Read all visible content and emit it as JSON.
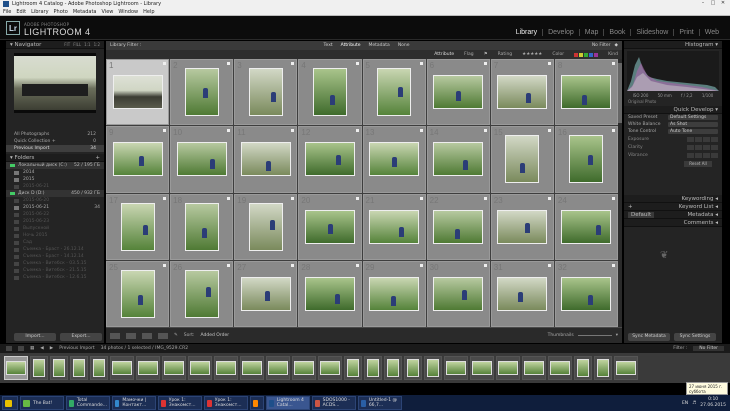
{
  "window": {
    "title": "Lightroom 4 Catalog - Adobe Photoshop Lightroom - Library"
  },
  "menu": [
    "File",
    "Edit",
    "Library",
    "Photo",
    "Metadata",
    "View",
    "Window",
    "Help"
  ],
  "identity": {
    "small": "ADOBE PHOTOSHOP",
    "big": "LIGHTROOM 4"
  },
  "modules": [
    "Library",
    "Develop",
    "Map",
    "Book",
    "Slideshow",
    "Print",
    "Web"
  ],
  "left": {
    "navigator": "Navigator",
    "nav_modes": [
      "FIT",
      "FILL",
      "1:1",
      "1:2"
    ],
    "catalog": [
      {
        "label": "All Photographs",
        "count": "212"
      },
      {
        "label": "Quick Collection +",
        "count": "0"
      },
      {
        "label": "Previous Import",
        "count": "34"
      }
    ],
    "folders_header": "Folders",
    "vol1": {
      "label": "Локальный диск (C:)",
      "info": "52 / 195 ГБ"
    },
    "vol2": {
      "label": "Диск D (D:)",
      "info": "450 / 932 ГБ"
    },
    "folders": [
      {
        "label": "2014",
        "count": "",
        "dim": false
      },
      {
        "label": "2015",
        "count": "",
        "dim": false
      },
      {
        "label": "2015-06-21",
        "count": "",
        "dim": true
      },
      {
        "label": "2015-06-20",
        "count": "",
        "dim": true
      },
      {
        "label": "2015-06-21",
        "count": "34",
        "dim": false
      },
      {
        "label": "2015-06-22",
        "count": "",
        "dim": true
      },
      {
        "label": "2015-06-23",
        "count": "",
        "dim": true
      },
      {
        "label": "Выпускной",
        "count": "",
        "dim": true
      },
      {
        "label": "Ночь 2015",
        "count": "",
        "dim": true
      },
      {
        "label": "Сад",
        "count": "",
        "dim": true
      },
      {
        "label": "Съемка - Браст - 26.12.14",
        "count": "",
        "dim": true
      },
      {
        "label": "Съемка - Браст - 14.12.14",
        "count": "",
        "dim": true
      },
      {
        "label": "Съемка - Витебск - 03.5.15",
        "count": "",
        "dim": true
      },
      {
        "label": "Съемка - Витебск - 21.5.15",
        "count": "",
        "dim": true
      },
      {
        "label": "Съемка - Витебск - 12.6.15",
        "count": "",
        "dim": true
      }
    ],
    "import_label": "Import...",
    "export_label": "Export..."
  },
  "center": {
    "filter_title": "Library Filter :",
    "filter_tabs": [
      "Text",
      "Attribute",
      "Metadata",
      "None"
    ],
    "filter_active": "Attribute",
    "no_filter": "No Filter",
    "attr_labels": [
      "Attribute",
      "Flag",
      "Rating",
      "Color",
      "Kind"
    ],
    "grid_numbers": [
      "1",
      "2",
      "3",
      "4",
      "5",
      "6",
      "7",
      "8",
      "9",
      "10",
      "11",
      "12",
      "13",
      "14",
      "15",
      "16",
      "17",
      "18",
      "19",
      "20",
      "21",
      "22",
      "23",
      "24",
      "25",
      "26",
      "27",
      "28",
      "29",
      "30",
      "31",
      "32"
    ],
    "sort_label": "Sort:",
    "sort_value": "Added Order",
    "thumbnails_label": "Thumbnails"
  },
  "right": {
    "histogram": "Histogram",
    "histo_info": [
      "ISO 200",
      "50 mm",
      "f / 2,2",
      "1/100"
    ],
    "original_photo": "Original Photo",
    "quick_develop": "Quick Develop",
    "saved_preset_label": "Saved Preset",
    "saved_preset_value": "Default Settings",
    "white_balance_label": "White Balance",
    "white_balance_value": "As Shot",
    "tone_control_label": "Tone Control",
    "tone_control_value": "Auto Tone",
    "tone_rows": [
      "Exposure",
      "Clarity",
      "Vibrance"
    ],
    "reset_all": "Reset All",
    "keywording": "Keywording",
    "keyword_list": "Keyword List",
    "metadata": "Metadata",
    "metadata_preset": "Default",
    "comments": "Comments",
    "sync_metadata": "Sync Metadata",
    "sync_settings": "Sync Settings"
  },
  "filmstrip": {
    "source": "Previous Import",
    "info": "34 photos / 1 selected / IMG_9529.CR2",
    "filter_label": "Filter :",
    "filter_value": "No Filter",
    "tooltip_line1": "27 июня 2015 г.",
    "tooltip_line2": "суббота"
  },
  "taskbar": {
    "items": [
      "The Bat!",
      "Total Commande...",
      "Мамочки | Контакт...",
      "Урок 1: Знакомст...",
      "Урок 1: Знакомст...",
      "",
      "Lightroom 4 Catal...",
      "SDOS1000 - ACDS...",
      "Untitled-1 @ 66,7..."
    ],
    "lang": "EN",
    "time": "0:10",
    "date": "27.06.2015"
  }
}
